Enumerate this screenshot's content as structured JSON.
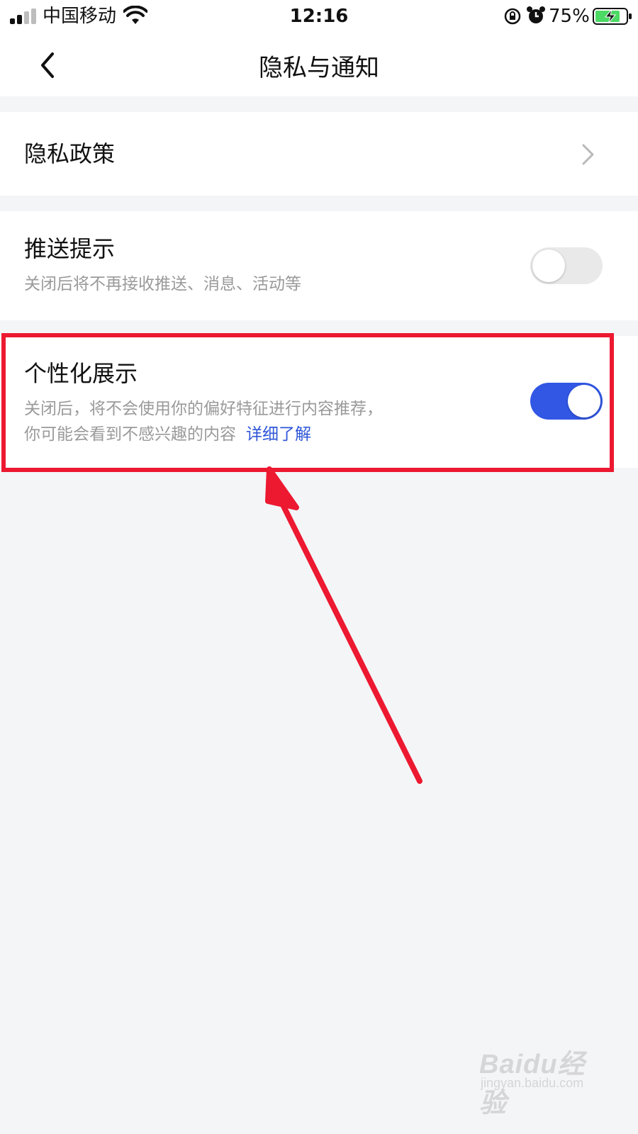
{
  "status_bar": {
    "carrier": "中国移动",
    "time": "12:16",
    "battery_percent": "75%",
    "icons": [
      "signal-icon",
      "wifi-icon",
      "rotation-lock-icon",
      "alarm-icon",
      "battery-charging-icon"
    ]
  },
  "nav": {
    "title": "隐私与通知",
    "back_icon": "chevron-left-icon"
  },
  "settings": {
    "privacy_policy": {
      "title": "隐私政策",
      "icon": "chevron-right-icon"
    },
    "push": {
      "title": "推送提示",
      "desc": "关闭后将不再接收推送、消息、活动等",
      "enabled": false
    },
    "personalized": {
      "title": "个性化展示",
      "desc_line1": "关闭后，将不会使用你的偏好特征进行内容推荐，",
      "desc_line2": "你可能会看到不感兴趣的内容",
      "link": "详细了解",
      "enabled": true
    }
  },
  "annotation": {
    "color": "#ec1930"
  },
  "colors": {
    "accent": "#3157e4",
    "link": "#2f57d8",
    "background": "#f4f5f7",
    "toggle_off": "#e9e9ea"
  },
  "watermark": {
    "logo": "Baidu经验",
    "sub": "jingyan.baidu.com"
  }
}
